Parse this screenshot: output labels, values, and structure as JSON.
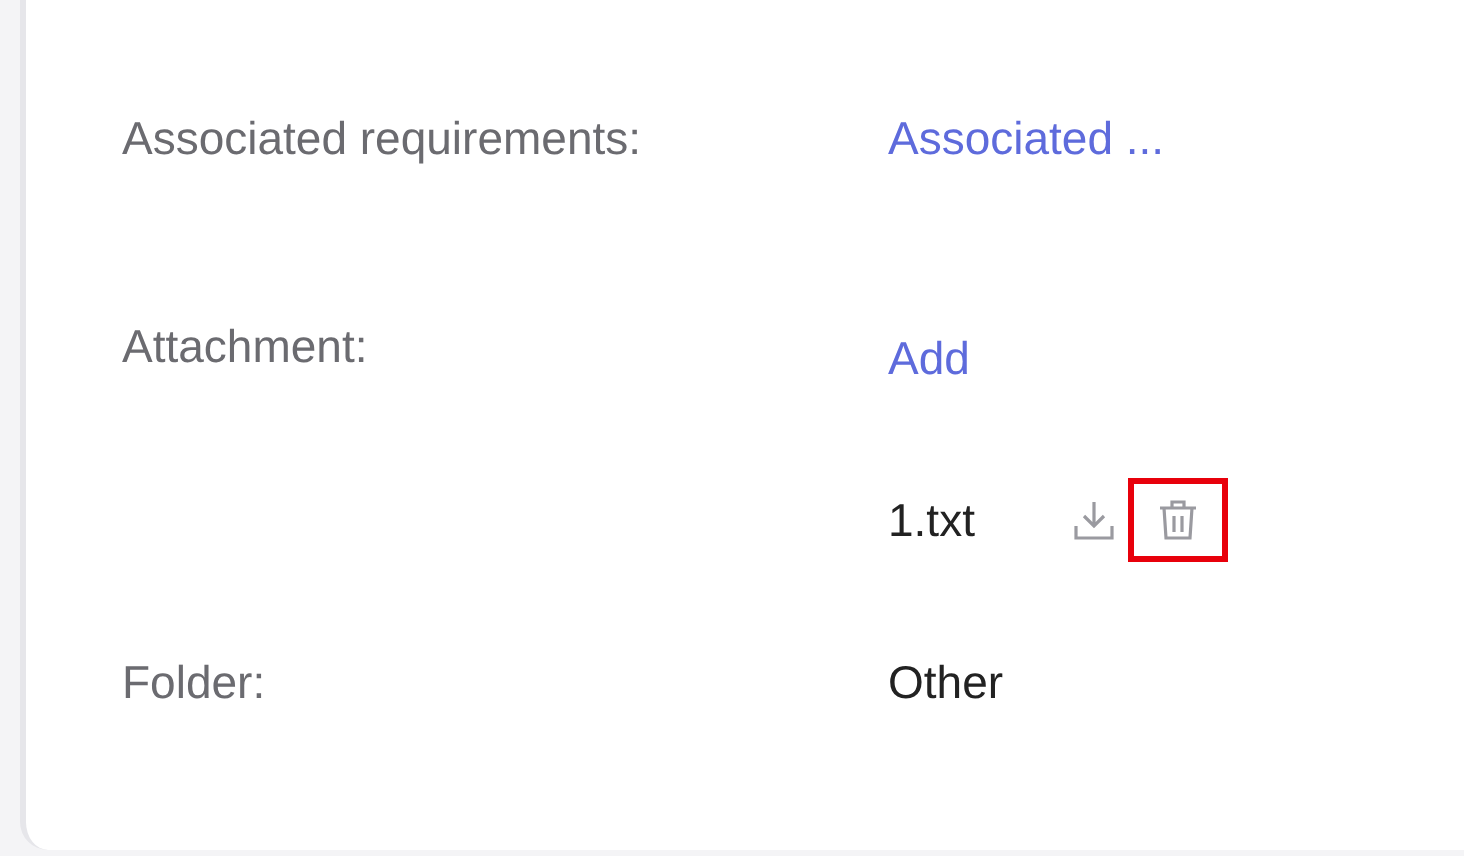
{
  "fields": [
    {
      "label": "Associated requirements:",
      "kind": "link",
      "value": "Associated ..."
    },
    {
      "label": "Attachment:",
      "kind": "attachments",
      "value": "Add",
      "files": [
        {
          "name": "1.txt",
          "delete_highlighted": true
        }
      ]
    },
    {
      "label": "Folder:",
      "kind": "text",
      "value": "Other"
    }
  ]
}
